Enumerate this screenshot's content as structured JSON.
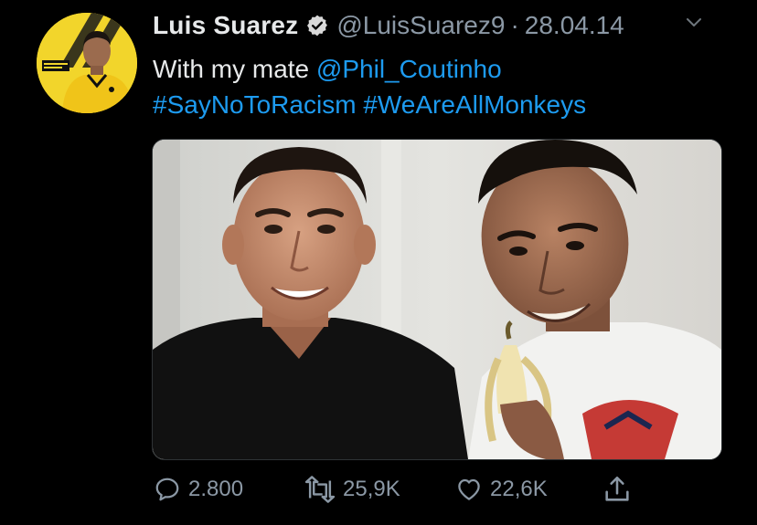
{
  "author": {
    "display_name": "Luis Suarez",
    "handle": "@LuisSuarez9",
    "separator": "·",
    "date": "28.04.14",
    "verified": true
  },
  "tweet": {
    "text_prefix": "With my mate ",
    "mention": "@Phil_Coutinho",
    "hashtag_1": "#SayNoToRacism",
    "hashtag_2": "#WeAreAllMonkeys"
  },
  "actions": {
    "replies": "2.800",
    "retweets": "25,9K",
    "likes": "22,6K"
  },
  "colors": {
    "background": "#000000",
    "text": "#e7e9ea",
    "muted": "#8b98a5",
    "link": "#1d9bf0",
    "avatar_bg": "#f2d52b"
  },
  "icons": {
    "reply": "reply-icon",
    "retweet": "retweet-icon",
    "like": "like-icon",
    "share": "share-icon",
    "verified": "verified-badge-icon",
    "caret": "chevron-down-icon"
  }
}
